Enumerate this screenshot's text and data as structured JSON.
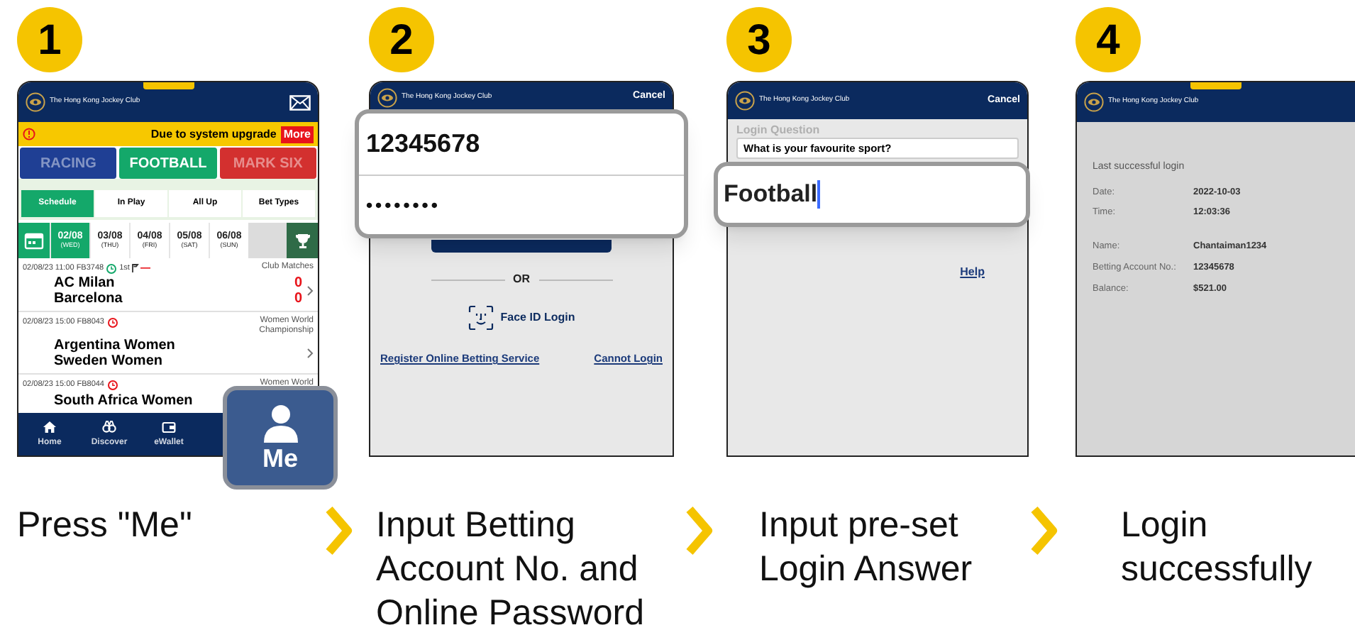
{
  "steps": [
    {
      "number": "1",
      "kind": "schedule",
      "caption": "Press \"Me\"",
      "screen": {
        "club": "The Hong Kong Jockey Club",
        "notice": {
          "text": "Due to system upgrade",
          "button": "More"
        },
        "sports": [
          {
            "label": "RACING",
            "selected": false,
            "color": "#1f3f94"
          },
          {
            "label": "FOOTBALL",
            "selected": true,
            "color": "#14a86a"
          },
          {
            "label": "MARK SIX",
            "selected": false,
            "color": "#d3302f"
          }
        ],
        "subtabs": [
          {
            "label": "Schedule",
            "selected": true
          },
          {
            "label": "In Play",
            "selected": false
          },
          {
            "label": "All Up",
            "selected": false
          },
          {
            "label": "Bet Types",
            "selected": false
          }
        ],
        "dates": [
          {
            "date": "02/08",
            "day": "(WED)",
            "selected": true
          },
          {
            "date": "03/08",
            "day": "(THU)",
            "selected": false
          },
          {
            "date": "04/08",
            "day": "(FRI)",
            "selected": false
          },
          {
            "date": "05/08",
            "day": "(SAT)",
            "selected": false
          },
          {
            "date": "06/08",
            "day": "(SUN)",
            "selected": false
          }
        ],
        "matches": [
          {
            "meta": "02/08/23 11:00 FB3748",
            "live": true,
            "period": "1st",
            "league": "Club Matches",
            "teams": [
              "AC Milan",
              "Barcelona"
            ],
            "scores": [
              "0",
              "0"
            ]
          },
          {
            "meta": "02/08/23 15:00 FB8043",
            "live": false,
            "league": "Women World Championship",
            "teams": [
              "Argentina Women",
              "Sweden Women"
            ]
          },
          {
            "meta": "02/08/23 15:00 FB8044",
            "live": false,
            "league": "Women World",
            "teams": [
              "South Africa Women"
            ]
          }
        ],
        "nav": [
          {
            "label": "Home",
            "kind": "home"
          },
          {
            "label": "Discover",
            "kind": "discover"
          },
          {
            "label": "eWallet",
            "kind": "wallet"
          }
        ],
        "me_button": "Me"
      }
    },
    {
      "number": "2",
      "kind": "login",
      "caption": "Input Betting Account No. and Online Password",
      "screen": {
        "club": "The Hong Kong Jockey Club",
        "cancel": "Cancel",
        "account": "12345678",
        "password": "••••••••",
        "divider": "OR",
        "face_id": "Face ID Login",
        "links": [
          "Register Online Betting Service",
          "Cannot Login"
        ]
      }
    },
    {
      "number": "3",
      "kind": "question",
      "caption": "Input pre-set Login Answer",
      "screen": {
        "club": "The Hong Kong Jockey Club",
        "cancel": "Cancel",
        "heading": "Login Question",
        "question": "What is your favourite sport?",
        "answer": "Football",
        "help": "Help"
      }
    },
    {
      "number": "4",
      "kind": "summary",
      "caption": "Login successfully",
      "screen": {
        "club": "The Hong Kong Jockey Club",
        "heading": "Last successful login",
        "login_rows": [
          {
            "label": "Date:",
            "value": "2022-10-03"
          },
          {
            "label": "Time:",
            "value": "12:03:36"
          }
        ],
        "account_rows": [
          {
            "label": "Name:",
            "value": "Chantaiman1234"
          },
          {
            "label": "Betting Account No.:",
            "value": "12345678"
          },
          {
            "label": "Balance:",
            "value": "$521.00"
          }
        ]
      }
    }
  ]
}
